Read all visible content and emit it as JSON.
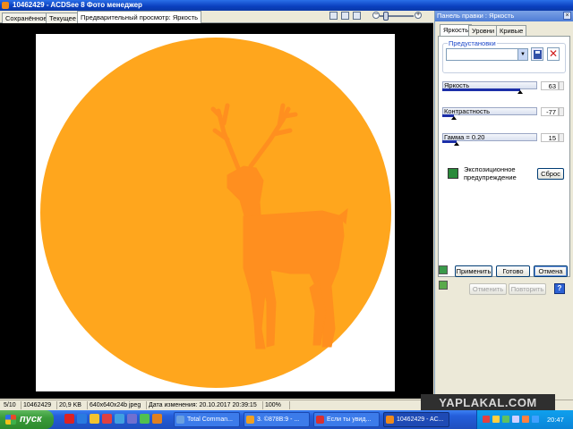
{
  "window": {
    "title": "10462429 - ACDSee 8 Фото менеджер"
  },
  "viewer": {
    "tabs": [
      {
        "label": "Сохранённое"
      },
      {
        "label": "Текущее"
      },
      {
        "label": "Предварительный просмотр: Яркость"
      }
    ],
    "image": {
      "background_color": "#ffa61d",
      "silhouette_color": "#ff8f1f",
      "subject": "deer-silhouette"
    }
  },
  "panel": {
    "title": "Панель правки : Яркость",
    "close_label": "×",
    "tabs": [
      {
        "label": "Яркость"
      },
      {
        "label": "Уровни"
      },
      {
        "label": "Кривые"
      }
    ],
    "presets_label": "Предустановки",
    "preset_value": "",
    "sliders": [
      {
        "label": "Яркость",
        "value": "63",
        "level": 0.82
      },
      {
        "label": "Контрастность",
        "value": "-77",
        "level": 0.12
      },
      {
        "label": "Гамма = 0.20",
        "value": "15",
        "level": 0.15
      }
    ],
    "warning_label": "Экспозиционное предупреждение",
    "reset_label": "Сброс",
    "apply_label": "Применить",
    "done_label": "Готово",
    "cancel_label": "Отмена",
    "undo_label": "Отменить",
    "redo_label": "Повторить",
    "help_label": "?"
  },
  "statusbar": {
    "index": "5/10",
    "name": "10462429",
    "size": "20,9 KB",
    "dims": "640x640x24b jpeg",
    "modified": "Дата изменения: 20.10.2017 20:39:15",
    "zoom": "100%"
  },
  "watermark": "YAPLAKAL.COM",
  "taskbar": {
    "start_label": "пуск",
    "tasks": [
      {
        "label": "Total Comman...",
        "icon_color": "#6aa0e0"
      },
      {
        "label": "3. ©878В:9 - ...",
        "icon_color": "#f0a020"
      },
      {
        "label": "Если ты увид...",
        "icon_color": "#d83030"
      },
      {
        "label": "10462429 - AC...",
        "icon_color": "#f08a1a"
      }
    ],
    "clock": "20:47"
  }
}
